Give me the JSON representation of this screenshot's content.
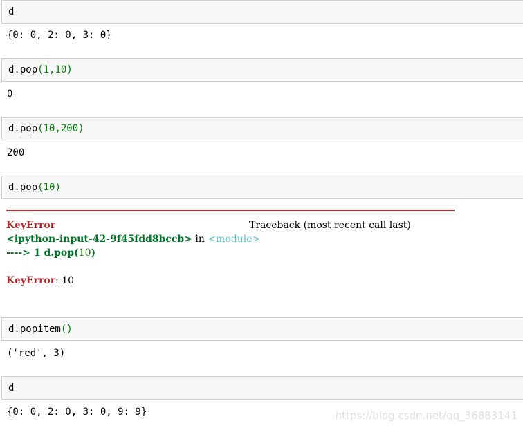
{
  "cells": [
    {
      "input_obj": "d",
      "input_method": "",
      "input_args": "",
      "output": "{0: 0, 2: 0, 3: 0}"
    },
    {
      "input_obj": "d.",
      "input_method": "pop",
      "input_args": "(1,10)",
      "output": "0"
    },
    {
      "input_obj": "d.",
      "input_method": "pop",
      "input_args": "(10,200)",
      "output": "200"
    },
    {
      "input_obj": "d.",
      "input_method": "pop",
      "input_args": "(10)"
    },
    {
      "input_obj": "d.",
      "input_method": "popitem",
      "input_args": "()",
      "output": "('red', 3)"
    },
    {
      "input_obj": "d",
      "input_method": "",
      "input_args": "",
      "output": "{0: 0, 2: 0, 3: 0, 9: 9}"
    }
  ],
  "traceback": {
    "error_name": "KeyError",
    "traceback_label": "Traceback (most recent call last)",
    "input_ref": "<ipython-input-42-9f45fdd8bccb>",
    "in_text": " in ",
    "module": "<module>",
    "arrow_line": "----> 1 d.pop(",
    "arrow_arg": "10",
    "arrow_close": ")",
    "final_error_name": "KeyError",
    "final_error_msg": ": 10"
  },
  "watermark": "https://blog.csdn.net/qq_36883141"
}
